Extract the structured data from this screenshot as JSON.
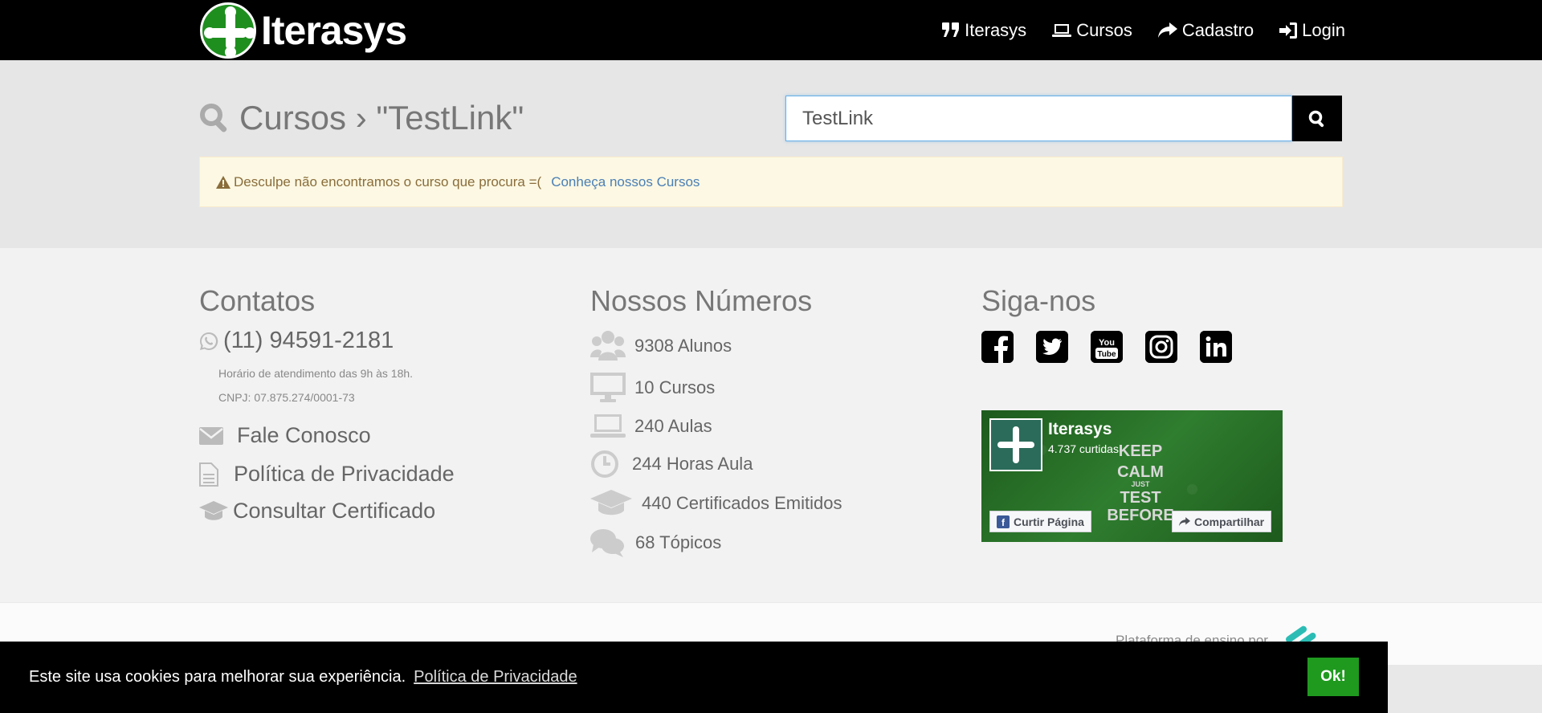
{
  "nav": {
    "brand": "Iterasys",
    "items": [
      {
        "label": "Iterasys",
        "icon": "quote-icon"
      },
      {
        "label": "Cursos",
        "icon": "laptop-icon"
      },
      {
        "label": "Cadastro",
        "icon": "share-icon"
      },
      {
        "label": "Login",
        "icon": "sign-in-icon"
      }
    ]
  },
  "search": {
    "title": "Cursos › \"TestLink\"",
    "value": "TestLink",
    "button_icon": "search-icon"
  },
  "alert": {
    "text": "Desculpe não encontramos o curso que procura =(",
    "link": "Conheça nossos Cursos"
  },
  "contatos": {
    "title": "Contatos",
    "phone": "(11) 94591-2181",
    "hours": "Horário de atendimento das 9h às 18h.",
    "cnpj": "CNPJ: 07.875.274/0001-73",
    "links": [
      "Fale Conosco",
      "Política de Privacidade",
      "Consultar Certificado"
    ]
  },
  "numeros": {
    "title": "Nossos Números",
    "items": [
      "9308 Alunos",
      "10 Cursos",
      "240 Aulas",
      "244 Horas Aula",
      "440 Certificados Emitidos",
      "68 Tópicos"
    ]
  },
  "siga": {
    "title": "Siga-nos",
    "networks": [
      "facebook-icon",
      "twitter-icon",
      "youtube-icon",
      "instagram-icon",
      "linkedin-icon"
    ],
    "fb_widget": {
      "name": "Iterasys",
      "likes": "4.737 curtidas",
      "image_text": [
        "KEEP",
        "CALM",
        "JUST",
        "TEST",
        "BEFORE"
      ],
      "like_button": "Curtir Página",
      "share_button": "Compartilhar"
    }
  },
  "bottom": {
    "platform": "Plataforma de ensino por"
  },
  "cookie": {
    "text": "Este site usa cookies para melhorar sua experiência.",
    "link": "Política de Privacidade",
    "button": "Ok!"
  },
  "colors": {
    "nav_bg": "#000000",
    "brand_green": "#1e8f1e",
    "alert_bg": "#fcf8e3",
    "link_blue": "#4a7fb5",
    "cookie_btn": "#1f9a1f"
  }
}
